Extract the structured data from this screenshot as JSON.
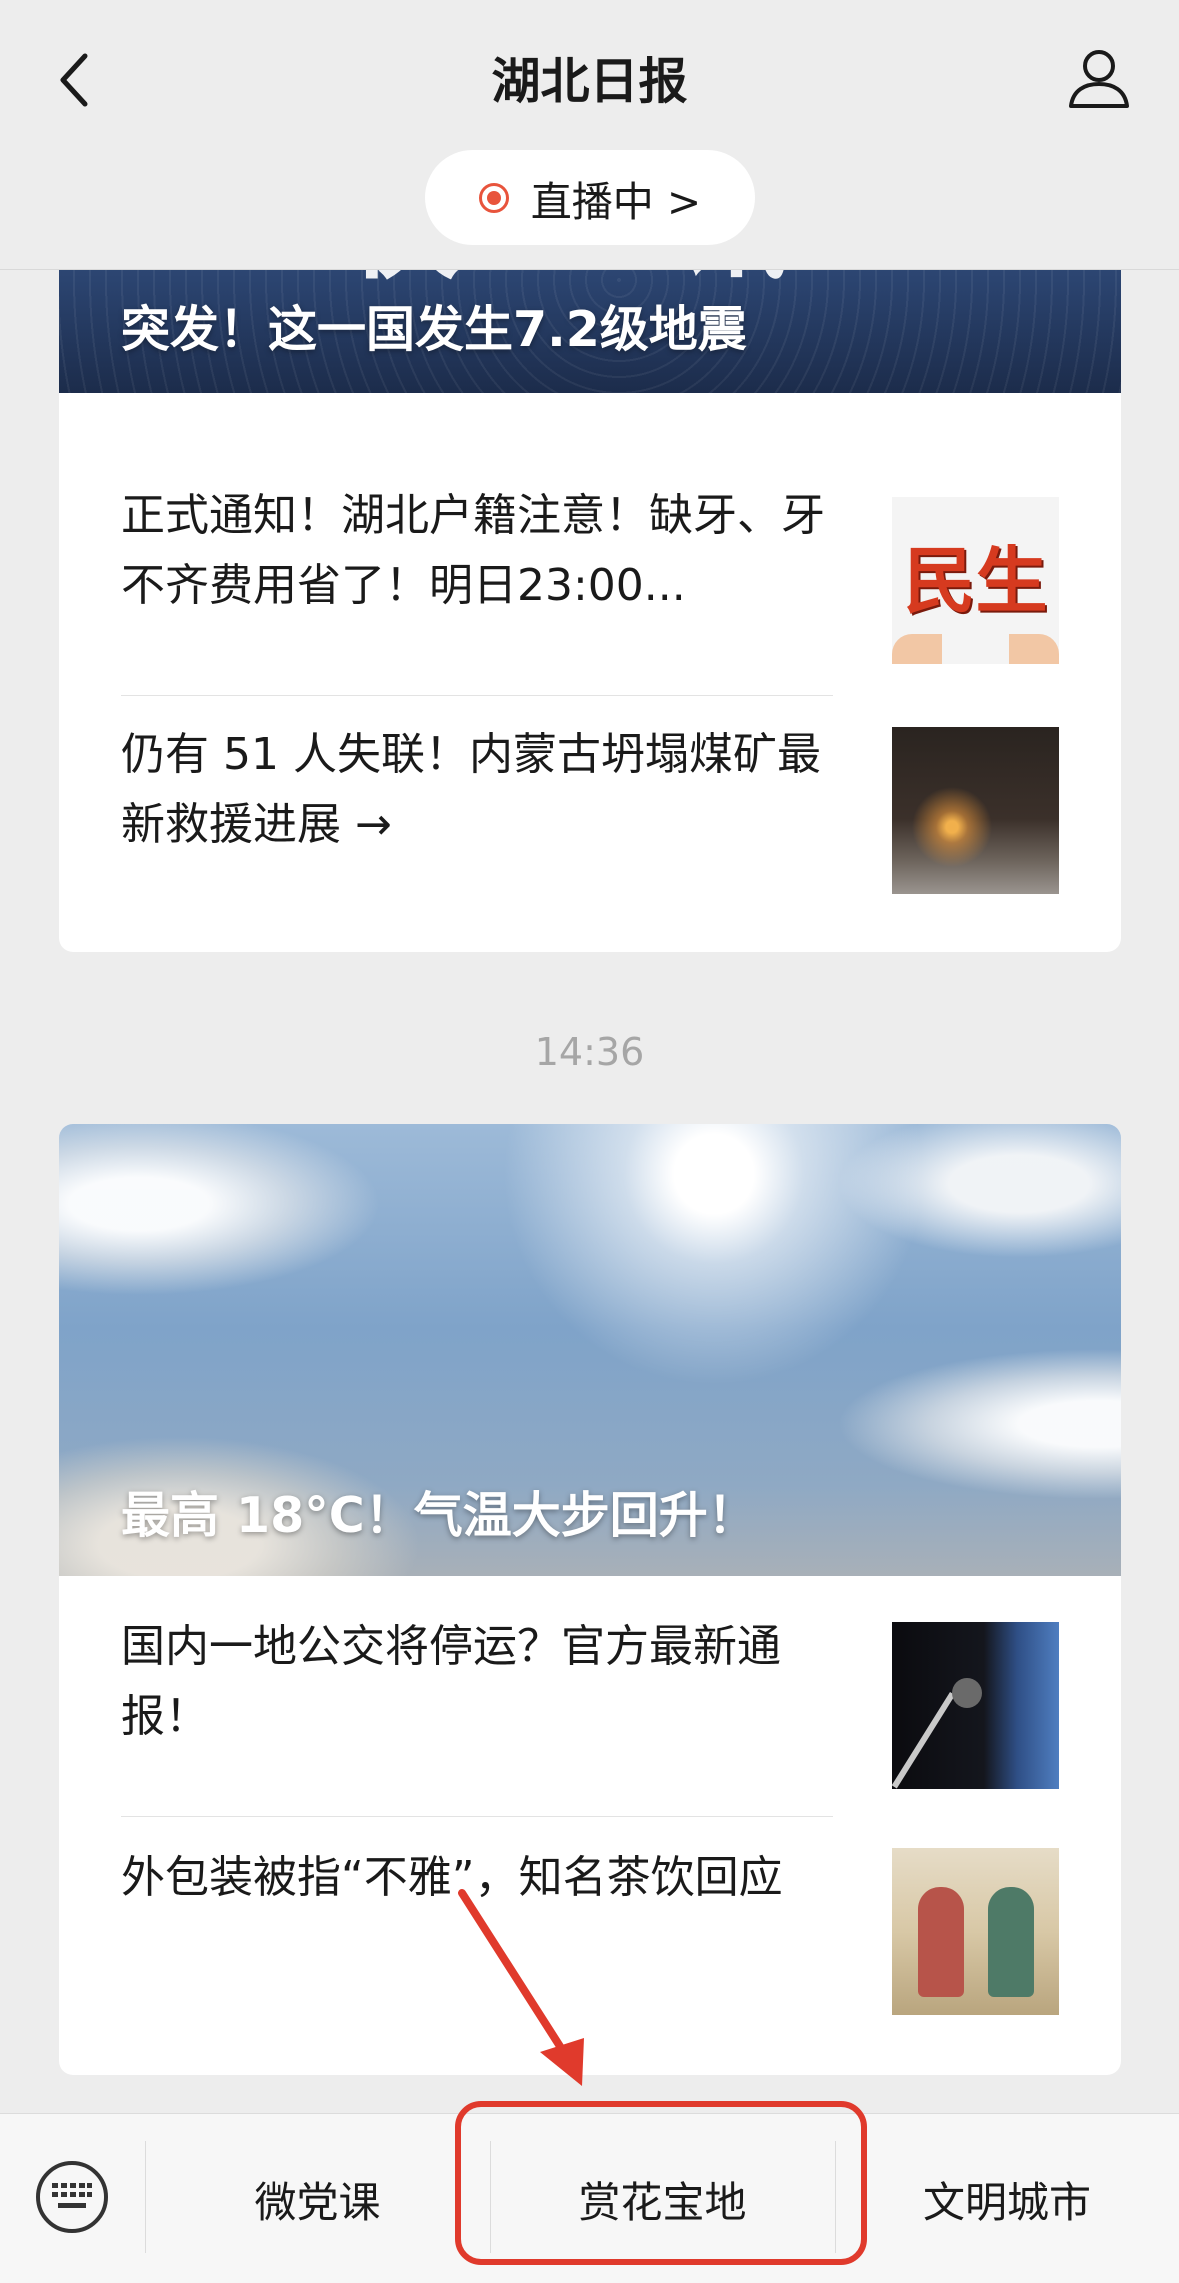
{
  "header": {
    "title": "湖北日报",
    "back_icon": "chevron-left-icon",
    "profile_icon": "person-icon",
    "live_label": "直播中 >",
    "live_color": "#e8543c"
  },
  "cards": [
    {
      "hero_caption": "突发！这一国发生7.2级地震",
      "hero_ghost_text": "快 讯",
      "articles": [
        {
          "title": "正式通知！湖北户籍注意！缺牙、牙不齐费用省了！明日23:00...",
          "thumb_text": "民生"
        },
        {
          "title": "仍有 51 人失联！内蒙古坍塌煤矿最新救援进展 →"
        }
      ]
    },
    {
      "hero_caption": "最高 18°C！气温大步回升！",
      "articles": [
        {
          "title": "国内一地公交将停运？官方最新通报！"
        },
        {
          "title": "外包装被指“不雅”，知名茶饮回应"
        }
      ]
    }
  ],
  "time_label": "14:36",
  "bottom_menu": {
    "keyboard_icon": "keyboard-icon",
    "items": [
      "微党课",
      "赏花宝地",
      "文明城市"
    ]
  },
  "annotation": {
    "color": "#e03a2c",
    "target": "赏花宝地"
  }
}
